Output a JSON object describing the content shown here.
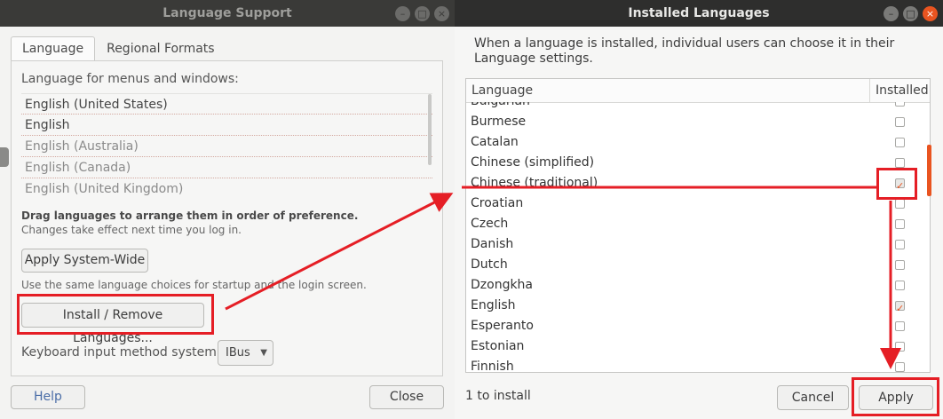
{
  "language_support": {
    "title": "Language Support",
    "tabs": [
      {
        "label": "Language"
      },
      {
        "label": "Regional Formats"
      }
    ],
    "section_label": "Language for menus and windows:",
    "languages": [
      {
        "label": "English (United States)"
      },
      {
        "label": "English"
      },
      {
        "label": "English (Australia)"
      },
      {
        "label": "English (Canada)"
      },
      {
        "label": "English (United Kingdom)"
      }
    ],
    "hint_bold": "Drag languages to arrange them in order of preference.",
    "hint_small": "Changes take effect next time you log in.",
    "apply_system_wide": "Apply System-Wide",
    "apply_hint": "Use the same language choices for startup and the login screen.",
    "install_remove": "Install / Remove Languages...",
    "keyboard_label": "Keyboard input method system:",
    "keyboard_value": "IBus",
    "help": "Help",
    "close": "Close"
  },
  "installed_languages": {
    "title": "Installed Languages",
    "description": "When a language is installed, individual users can choose it in their Language settings.",
    "col_language": "Language",
    "col_installed": "Installed",
    "rows": [
      {
        "name": "Bulgarian",
        "installed": false
      },
      {
        "name": "Burmese",
        "installed": false
      },
      {
        "name": "Catalan",
        "installed": false
      },
      {
        "name": "Chinese (simplified)",
        "installed": false
      },
      {
        "name": "Chinese (traditional)",
        "installed": true
      },
      {
        "name": "Croatian",
        "installed": false
      },
      {
        "name": "Czech",
        "installed": false
      },
      {
        "name": "Danish",
        "installed": false
      },
      {
        "name": "Dutch",
        "installed": false
      },
      {
        "name": "Dzongkha",
        "installed": false
      },
      {
        "name": "English",
        "installed": true
      },
      {
        "name": "Esperanto",
        "installed": false
      },
      {
        "name": "Estonian",
        "installed": false
      },
      {
        "name": "Finnish",
        "installed": false
      }
    ],
    "status": "1 to install",
    "cancel": "Cancel",
    "apply": "Apply"
  },
  "window_buttons": {
    "minimize": "–",
    "maximize": "□",
    "close": "×"
  },
  "colors": {
    "accent": "#e95420",
    "annotation": "#e51e25"
  }
}
